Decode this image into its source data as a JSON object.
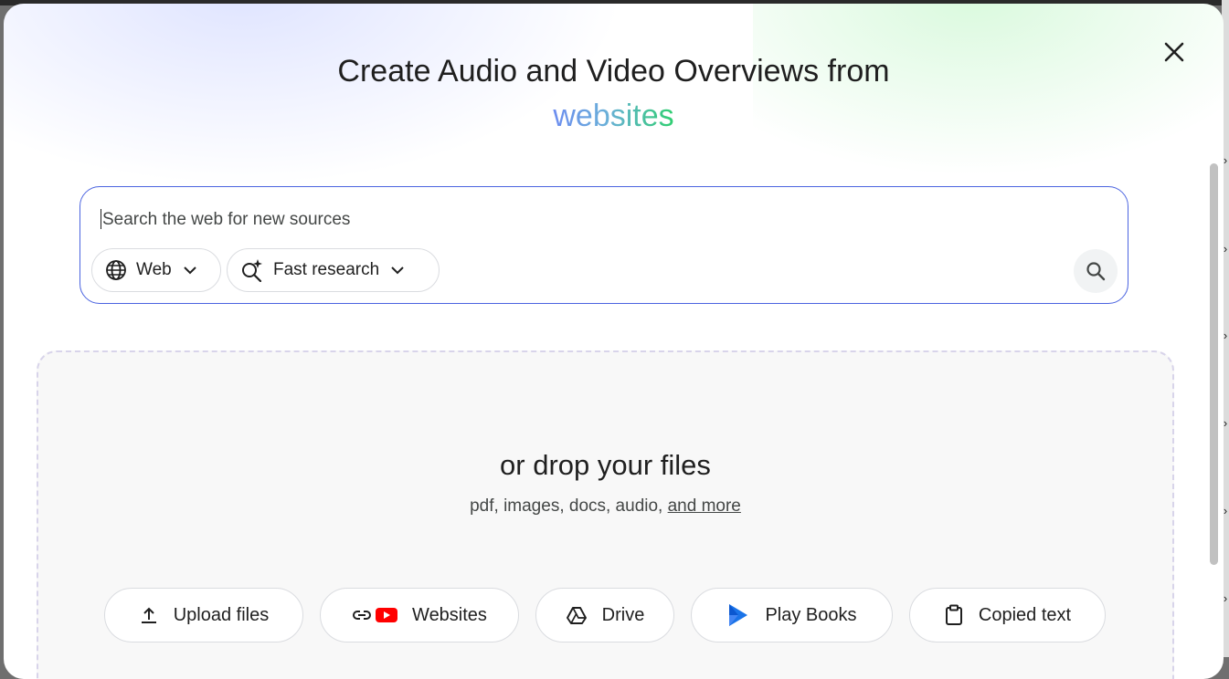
{
  "dialog": {
    "title": "Create Audio and Video Overviews from",
    "title_accent": "websites",
    "close_icon": "close-icon"
  },
  "search": {
    "placeholder": "Search the web for new sources",
    "value": "",
    "source_chip": {
      "label": "Web",
      "icon": "globe-icon"
    },
    "mode_chip": {
      "label": "Fast research",
      "icon": "sparkle-search-icon"
    },
    "submit_icon": "search-icon"
  },
  "dropzone": {
    "title": "or drop your files",
    "subtitle": "pdf, images, docs, audio, ",
    "more_link": "and more"
  },
  "sources": [
    {
      "label": "Upload files",
      "icon": "upload-icon"
    },
    {
      "label": "Websites",
      "icon": "link-youtube-icon"
    },
    {
      "label": "Drive",
      "icon": "drive-icon"
    },
    {
      "label": "Play Books",
      "icon": "play-books-icon"
    },
    {
      "label": "Copied text",
      "icon": "clipboard-icon"
    }
  ],
  "colors": {
    "accent_border": "#4a63e0",
    "accent_gradient_start": "#6d8df0",
    "accent_gradient_end": "#2fcf70",
    "youtube_red": "#ff0000"
  }
}
